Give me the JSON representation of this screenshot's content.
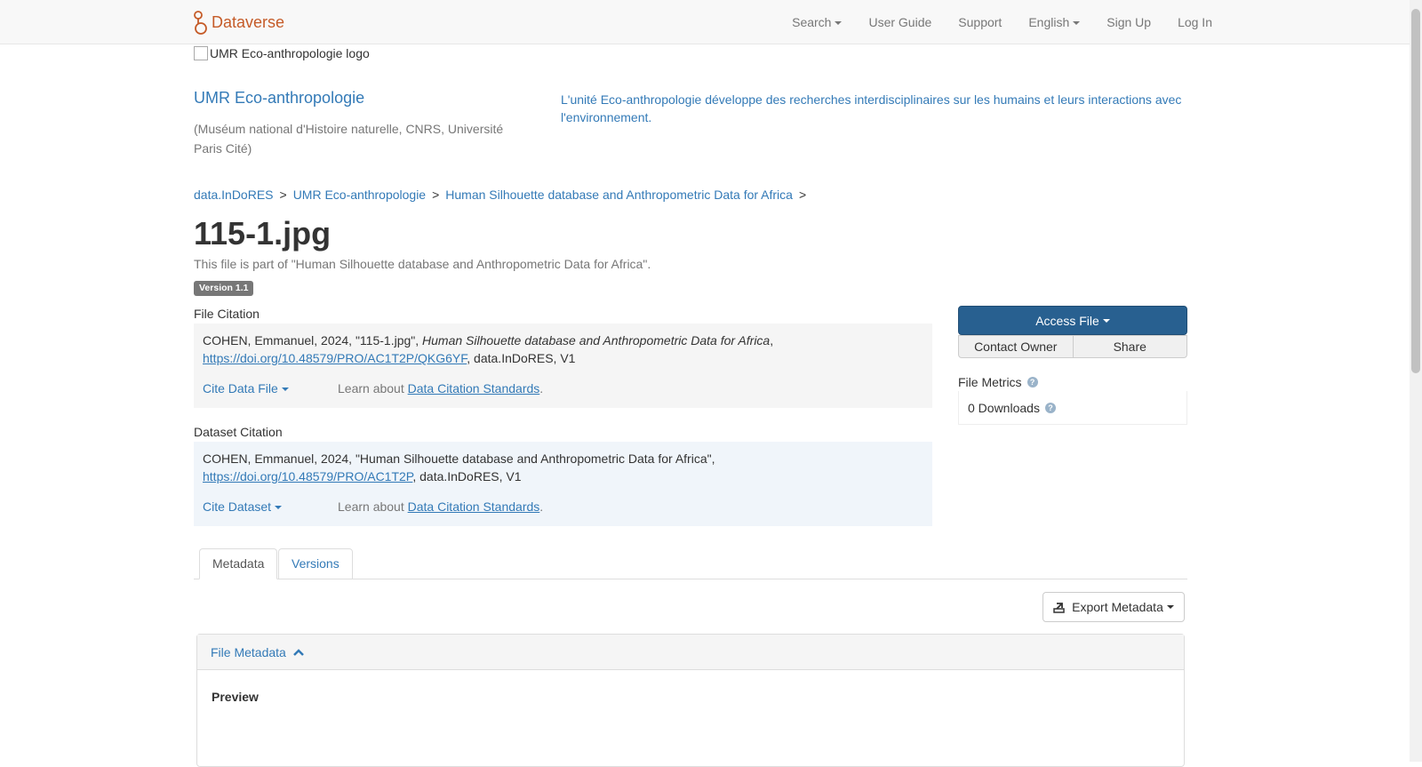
{
  "navbar": {
    "brand": "Dataverse",
    "items": {
      "search": "Search",
      "user_guide": "User Guide",
      "support": "Support",
      "language": "English",
      "sign_up": "Sign Up",
      "log_in": "Log In"
    }
  },
  "header": {
    "logo_alt": "UMR Eco-anthropologie logo",
    "name": "UMR Eco-anthropologie",
    "affiliation": "(Muséum national d'Histoire naturelle, CNRS, Université Paris Cité)",
    "description": "L'unité Eco-anthropologie développe des recherches interdisciplinaires sur les humains et leurs interactions avec l'environnement."
  },
  "breadcrumb": [
    "data.InDoRES",
    "UMR Eco-anthropologie",
    "Human Silhouette database and Anthropometric Data for Africa"
  ],
  "breadcrumb_sep": ">",
  "file": {
    "title": "115-1.jpg",
    "part_of": "This file is part of \"Human Silhouette database and Anthropometric Data for Africa\".",
    "version": "Version 1.1"
  },
  "file_citation": {
    "label": "File Citation",
    "prefix": "COHEN, Emmanuel, 2024, \"115-1.jpg\", ",
    "italic": "Human Silhouette database and Anthropometric Data for Africa",
    "comma": ",",
    "doi": "https://doi.org/10.48579/PRO/AC1T2P/QKG6YF",
    "suffix": ", data.InDoRES, V1",
    "cite_label": "Cite Data File",
    "learn_prefix": "Learn about ",
    "learn_link": "Data Citation Standards",
    "learn_suffix": "."
  },
  "dataset_citation": {
    "label": "Dataset Citation",
    "prefix": "COHEN, Emmanuel, 2024, \"Human Silhouette database and Anthropometric Data for Africa\", ",
    "doi": "https://doi.org/10.48579/PRO/AC1T2P",
    "suffix": ", data.InDoRES, V1",
    "cite_label": "Cite Dataset",
    "learn_prefix": "Learn about ",
    "learn_link": "Data Citation Standards",
    "learn_suffix": "."
  },
  "actions": {
    "access_file": "Access File",
    "contact_owner": "Contact Owner",
    "share": "Share"
  },
  "metrics": {
    "label": "File Metrics",
    "downloads": "0 Downloads",
    "help_glyph": "?"
  },
  "tabs": [
    "Metadata",
    "Versions"
  ],
  "export_label": "Export Metadata",
  "panel": {
    "title": "File Metadata",
    "preview_label": "Preview"
  }
}
